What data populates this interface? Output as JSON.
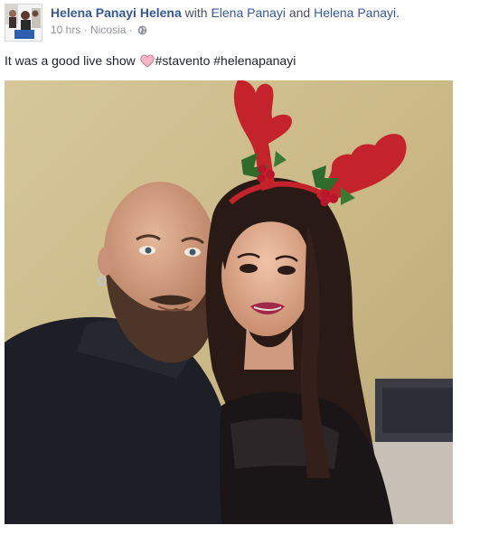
{
  "post": {
    "author": "Helena Panayi Helena",
    "with_label": " with ",
    "tagged_1": "Elena Panayi",
    "and_label": " and ",
    "tagged_2": "Helena Panayi",
    "period": ".",
    "time": "10 hrs",
    "separator": " · ",
    "location": "Nicosia",
    "separator_2": " · ",
    "privacy_icon": "globe-icon",
    "message_before": "It was a good live show ",
    "message_emoji": "heart-emoji",
    "message_after": "#stavento #helenapanayi"
  },
  "colors": {
    "link": "#365899",
    "meta": "#90949c",
    "heart": "#f4b6c6"
  }
}
